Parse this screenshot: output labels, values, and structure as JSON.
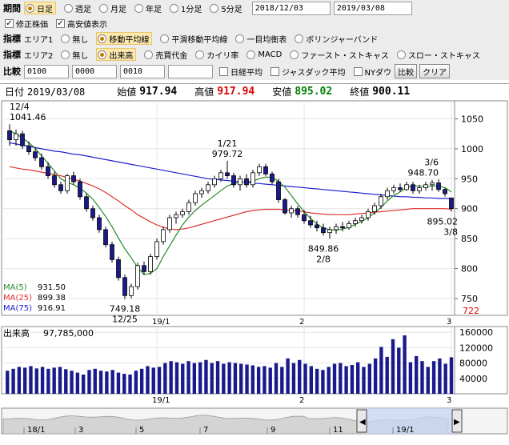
{
  "toolbar": {
    "period_label": "期間",
    "period_options": [
      "日足",
      "週足",
      "月足",
      "年足",
      "1分足",
      "5分足"
    ],
    "period_selected": 0,
    "date_from": "2018/12/03",
    "date_to": "2019/03/08",
    "check_adjusted": "修正株価",
    "check_highlow": "高安値表示",
    "indicator_label": "指標",
    "area1_label": "エリア1",
    "area1_options": [
      "無し",
      "移動平均線",
      "平滑移動平均線",
      "一目均衡表",
      "ボリンジャーバンド"
    ],
    "area1_selected": 1,
    "area2_label": "エリア2",
    "area2_options": [
      "無し",
      "出来高",
      "売買代金",
      "カイリ率",
      "MACD",
      "ファースト・ストキャス",
      "スロー・ストキャス"
    ],
    "area2_selected": 1,
    "compare_label": "比較",
    "compare_inputs": [
      "0100",
      "0000",
      "0010",
      ""
    ],
    "compare_checks": [
      "日経平均",
      "ジャスダック平均",
      "NYダウ"
    ],
    "compare_button": "比較",
    "clear_button": "クリア"
  },
  "infobar": {
    "date_label": "日付",
    "date": "2019/03/08",
    "open_label": "始値",
    "open": "917.94",
    "high_label": "高値",
    "high": "917.94",
    "low_label": "安値",
    "low": "895.02",
    "close_label": "終値",
    "close": "900.11"
  },
  "colors": {
    "up": "#ffffff",
    "down": "#1a1a8c",
    "ma5": "#2a8a2a",
    "ma25": "#e03030",
    "ma75": "#2020d0",
    "volume": "#1a1a8c"
  },
  "chart_data": [
    {
      "type": "candlestick",
      "ylim": [
        722,
        1080
      ],
      "yticks": [
        750,
        800,
        850,
        900,
        950,
        1000,
        1050
      ],
      "ymin_label": "722",
      "xticks": [
        {
          "i": 23,
          "label": "19/1"
        },
        {
          "i": 46,
          "label": "2"
        },
        {
          "i": 69,
          "label": "3"
        }
      ],
      "candles": [
        [
          1030,
          1041,
          1005,
          1015
        ],
        [
          1015,
          1032,
          1005,
          1025
        ],
        [
          1025,
          1030,
          1000,
          1005
        ],
        [
          1005,
          1012,
          990,
          995
        ],
        [
          995,
          1002,
          980,
          985
        ],
        [
          985,
          992,
          965,
          970
        ],
        [
          970,
          978,
          950,
          955
        ],
        [
          955,
          962,
          935,
          940
        ],
        [
          940,
          945,
          925,
          930
        ],
        [
          930,
          958,
          925,
          955
        ],
        [
          955,
          962,
          940,
          945
        ],
        [
          945,
          950,
          915,
          920
        ],
        [
          920,
          925,
          895,
          900
        ],
        [
          900,
          905,
          880,
          885
        ],
        [
          885,
          890,
          860,
          865
        ],
        [
          865,
          870,
          835,
          840
        ],
        [
          840,
          845,
          810,
          815
        ],
        [
          815,
          820,
          780,
          785
        ],
        [
          785,
          790,
          749,
          755
        ],
        [
          755,
          775,
          750,
          770
        ],
        [
          770,
          810,
          765,
          805
        ],
        [
          805,
          812,
          790,
          795
        ],
        [
          795,
          825,
          790,
          820
        ],
        [
          820,
          850,
          815,
          845
        ],
        [
          845,
          870,
          840,
          865
        ],
        [
          865,
          890,
          860,
          885
        ],
        [
          885,
          895,
          875,
          890
        ],
        [
          890,
          900,
          885,
          895
        ],
        [
          895,
          915,
          890,
          910
        ],
        [
          910,
          930,
          905,
          925
        ],
        [
          925,
          935,
          918,
          930
        ],
        [
          930,
          945,
          925,
          940
        ],
        [
          940,
          955,
          935,
          950
        ],
        [
          950,
          965,
          945,
          960
        ],
        [
          960,
          980,
          950,
          955
        ],
        [
          955,
          960,
          935,
          940
        ],
        [
          940,
          955,
          930,
          950
        ],
        [
          950,
          958,
          935,
          940
        ],
        [
          940,
          965,
          935,
          960
        ],
        [
          960,
          975,
          955,
          970
        ],
        [
          970,
          975,
          955,
          958
        ],
        [
          958,
          962,
          940,
          945
        ],
        [
          945,
          950,
          910,
          915
        ],
        [
          915,
          918,
          890,
          893
        ],
        [
          893,
          905,
          885,
          900
        ],
        [
          900,
          905,
          885,
          890
        ],
        [
          890,
          898,
          875,
          880
        ],
        [
          880,
          888,
          868,
          873
        ],
        [
          873,
          880,
          862,
          868
        ],
        [
          868,
          875,
          855,
          860
        ],
        [
          860,
          870,
          850,
          865
        ],
        [
          865,
          875,
          858,
          870
        ],
        [
          870,
          878,
          862,
          868
        ],
        [
          868,
          880,
          865,
          875
        ],
        [
          875,
          885,
          870,
          880
        ],
        [
          880,
          890,
          875,
          885
        ],
        [
          885,
          900,
          880,
          895
        ],
        [
          895,
          910,
          890,
          905
        ],
        [
          905,
          925,
          900,
          920
        ],
        [
          920,
          935,
          915,
          930
        ],
        [
          930,
          940,
          925,
          935
        ],
        [
          935,
          942,
          928,
          932
        ],
        [
          932,
          945,
          930,
          940
        ],
        [
          940,
          945,
          925,
          930
        ],
        [
          930,
          940,
          925,
          935
        ],
        [
          935,
          945,
          930,
          940
        ],
        [
          940,
          948,
          930,
          943
        ],
        [
          943,
          949,
          928,
          932
        ],
        [
          932,
          935,
          920,
          925
        ],
        [
          917.94,
          917.94,
          895.02,
          900.11
        ]
      ],
      "ma5": [
        1030,
        1025,
        1018,
        1010,
        1001,
        988,
        976,
        963,
        950,
        944,
        940,
        934,
        926,
        916,
        902,
        887,
        870,
        851,
        833,
        818,
        802,
        790,
        792,
        800,
        820,
        838,
        856,
        873,
        886,
        897,
        906,
        914,
        922,
        930,
        938,
        942,
        944,
        945,
        946,
        950,
        953,
        952,
        946,
        936,
        922,
        908,
        895,
        884,
        874,
        868,
        865,
        864,
        866,
        869,
        874,
        879,
        885,
        893,
        902,
        913,
        922,
        928,
        935,
        938,
        938,
        937,
        938,
        938,
        935,
        928
      ],
      "ma25": [
        970,
        968,
        966,
        965,
        963,
        961,
        959,
        957,
        955,
        952,
        949,
        946,
        942,
        938,
        933,
        927,
        920,
        913,
        905,
        898,
        890,
        884,
        878,
        873,
        869,
        866,
        865,
        866,
        868,
        871,
        874,
        877,
        880,
        883,
        886,
        889,
        892,
        895,
        897,
        898,
        899,
        899,
        899,
        898,
        897,
        896,
        895,
        893,
        892,
        891,
        890,
        890,
        890,
        890,
        891,
        892,
        893,
        894,
        895,
        896,
        897,
        898,
        899,
        900,
        900,
        900,
        900,
        900,
        900,
        899
      ],
      "ma75": [
        1010,
        1008,
        1006,
        1004,
        1002,
        1000,
        998,
        996,
        995,
        993,
        991,
        990,
        988,
        986,
        984,
        982,
        980,
        978,
        976,
        974,
        972,
        970,
        968,
        966,
        964,
        962,
        960,
        958,
        956,
        954,
        952,
        950,
        949,
        948,
        947,
        946,
        945,
        944,
        943,
        942,
        941,
        940,
        939,
        938,
        937,
        936,
        935,
        934,
        933,
        932,
        931,
        930,
        929,
        928,
        927,
        926,
        925,
        924,
        923,
        922,
        921,
        920,
        920,
        919,
        919,
        918,
        918,
        917,
        917,
        917
      ],
      "annotations": [
        {
          "i": 0,
          "value": 1041.46,
          "date": "12/4",
          "pos": "above"
        },
        {
          "i": 34,
          "value": 979.72,
          "date": "1/21",
          "pos": "above"
        },
        {
          "i": 18,
          "value": 749.18,
          "date": "12/25",
          "pos": "below"
        },
        {
          "i": 49,
          "value": 849.86,
          "date": "2/8",
          "pos": "below"
        },
        {
          "i": 66,
          "value": 948.7,
          "date": "3/6",
          "pos": "above"
        },
        {
          "i": 69,
          "value": 895.02,
          "date": "3/8",
          "pos": "below"
        }
      ],
      "legend": [
        {
          "name": "MA(5)",
          "value": "931.50",
          "color": "#2a8a2a"
        },
        {
          "name": "MA(25)",
          "value": "899.38",
          "color": "#e03030"
        },
        {
          "name": "MA(75)",
          "value": "916.91",
          "color": "#2020d0"
        }
      ]
    },
    {
      "type": "bar",
      "title": "出来高",
      "title_value": "97,785,000",
      "ylim": [
        0,
        175000
      ],
      "yticks": [
        40000,
        80000,
        120000,
        160000
      ],
      "values": [
        60000,
        65000,
        70000,
        68000,
        72000,
        66000,
        70000,
        65000,
        68000,
        70000,
        64000,
        60000,
        55000,
        50000,
        62000,
        65000,
        60000,
        58000,
        62000,
        55000,
        52000,
        50000,
        60000,
        65000,
        72000,
        68000,
        70000,
        80000,
        85000,
        82000,
        78000,
        85000,
        80000,
        82000,
        88000,
        80000,
        85000,
        78000,
        82000,
        80000,
        78000,
        76000,
        74000,
        70000,
        72000,
        68000,
        80000,
        70000,
        92000,
        80000,
        88000,
        78000,
        72000,
        65000,
        62000,
        70000,
        78000,
        80000,
        72000,
        75000,
        82000,
        70000,
        78000,
        92000,
        122000,
        96000,
        142000,
        120000,
        152000,
        82000,
        98000,
        85000,
        70000,
        85000,
        92000,
        78000,
        95000
      ]
    },
    {
      "type": "area",
      "xticks": [
        {
          "x": 36,
          "label": "18/1"
        },
        {
          "x": 100,
          "label": "3"
        },
        {
          "x": 176,
          "label": "5"
        },
        {
          "x": 256,
          "label": "7"
        },
        {
          "x": 340,
          "label": "9"
        },
        {
          "x": 418,
          "label": "11"
        },
        {
          "x": 497,
          "label": "19/1"
        }
      ]
    }
  ]
}
